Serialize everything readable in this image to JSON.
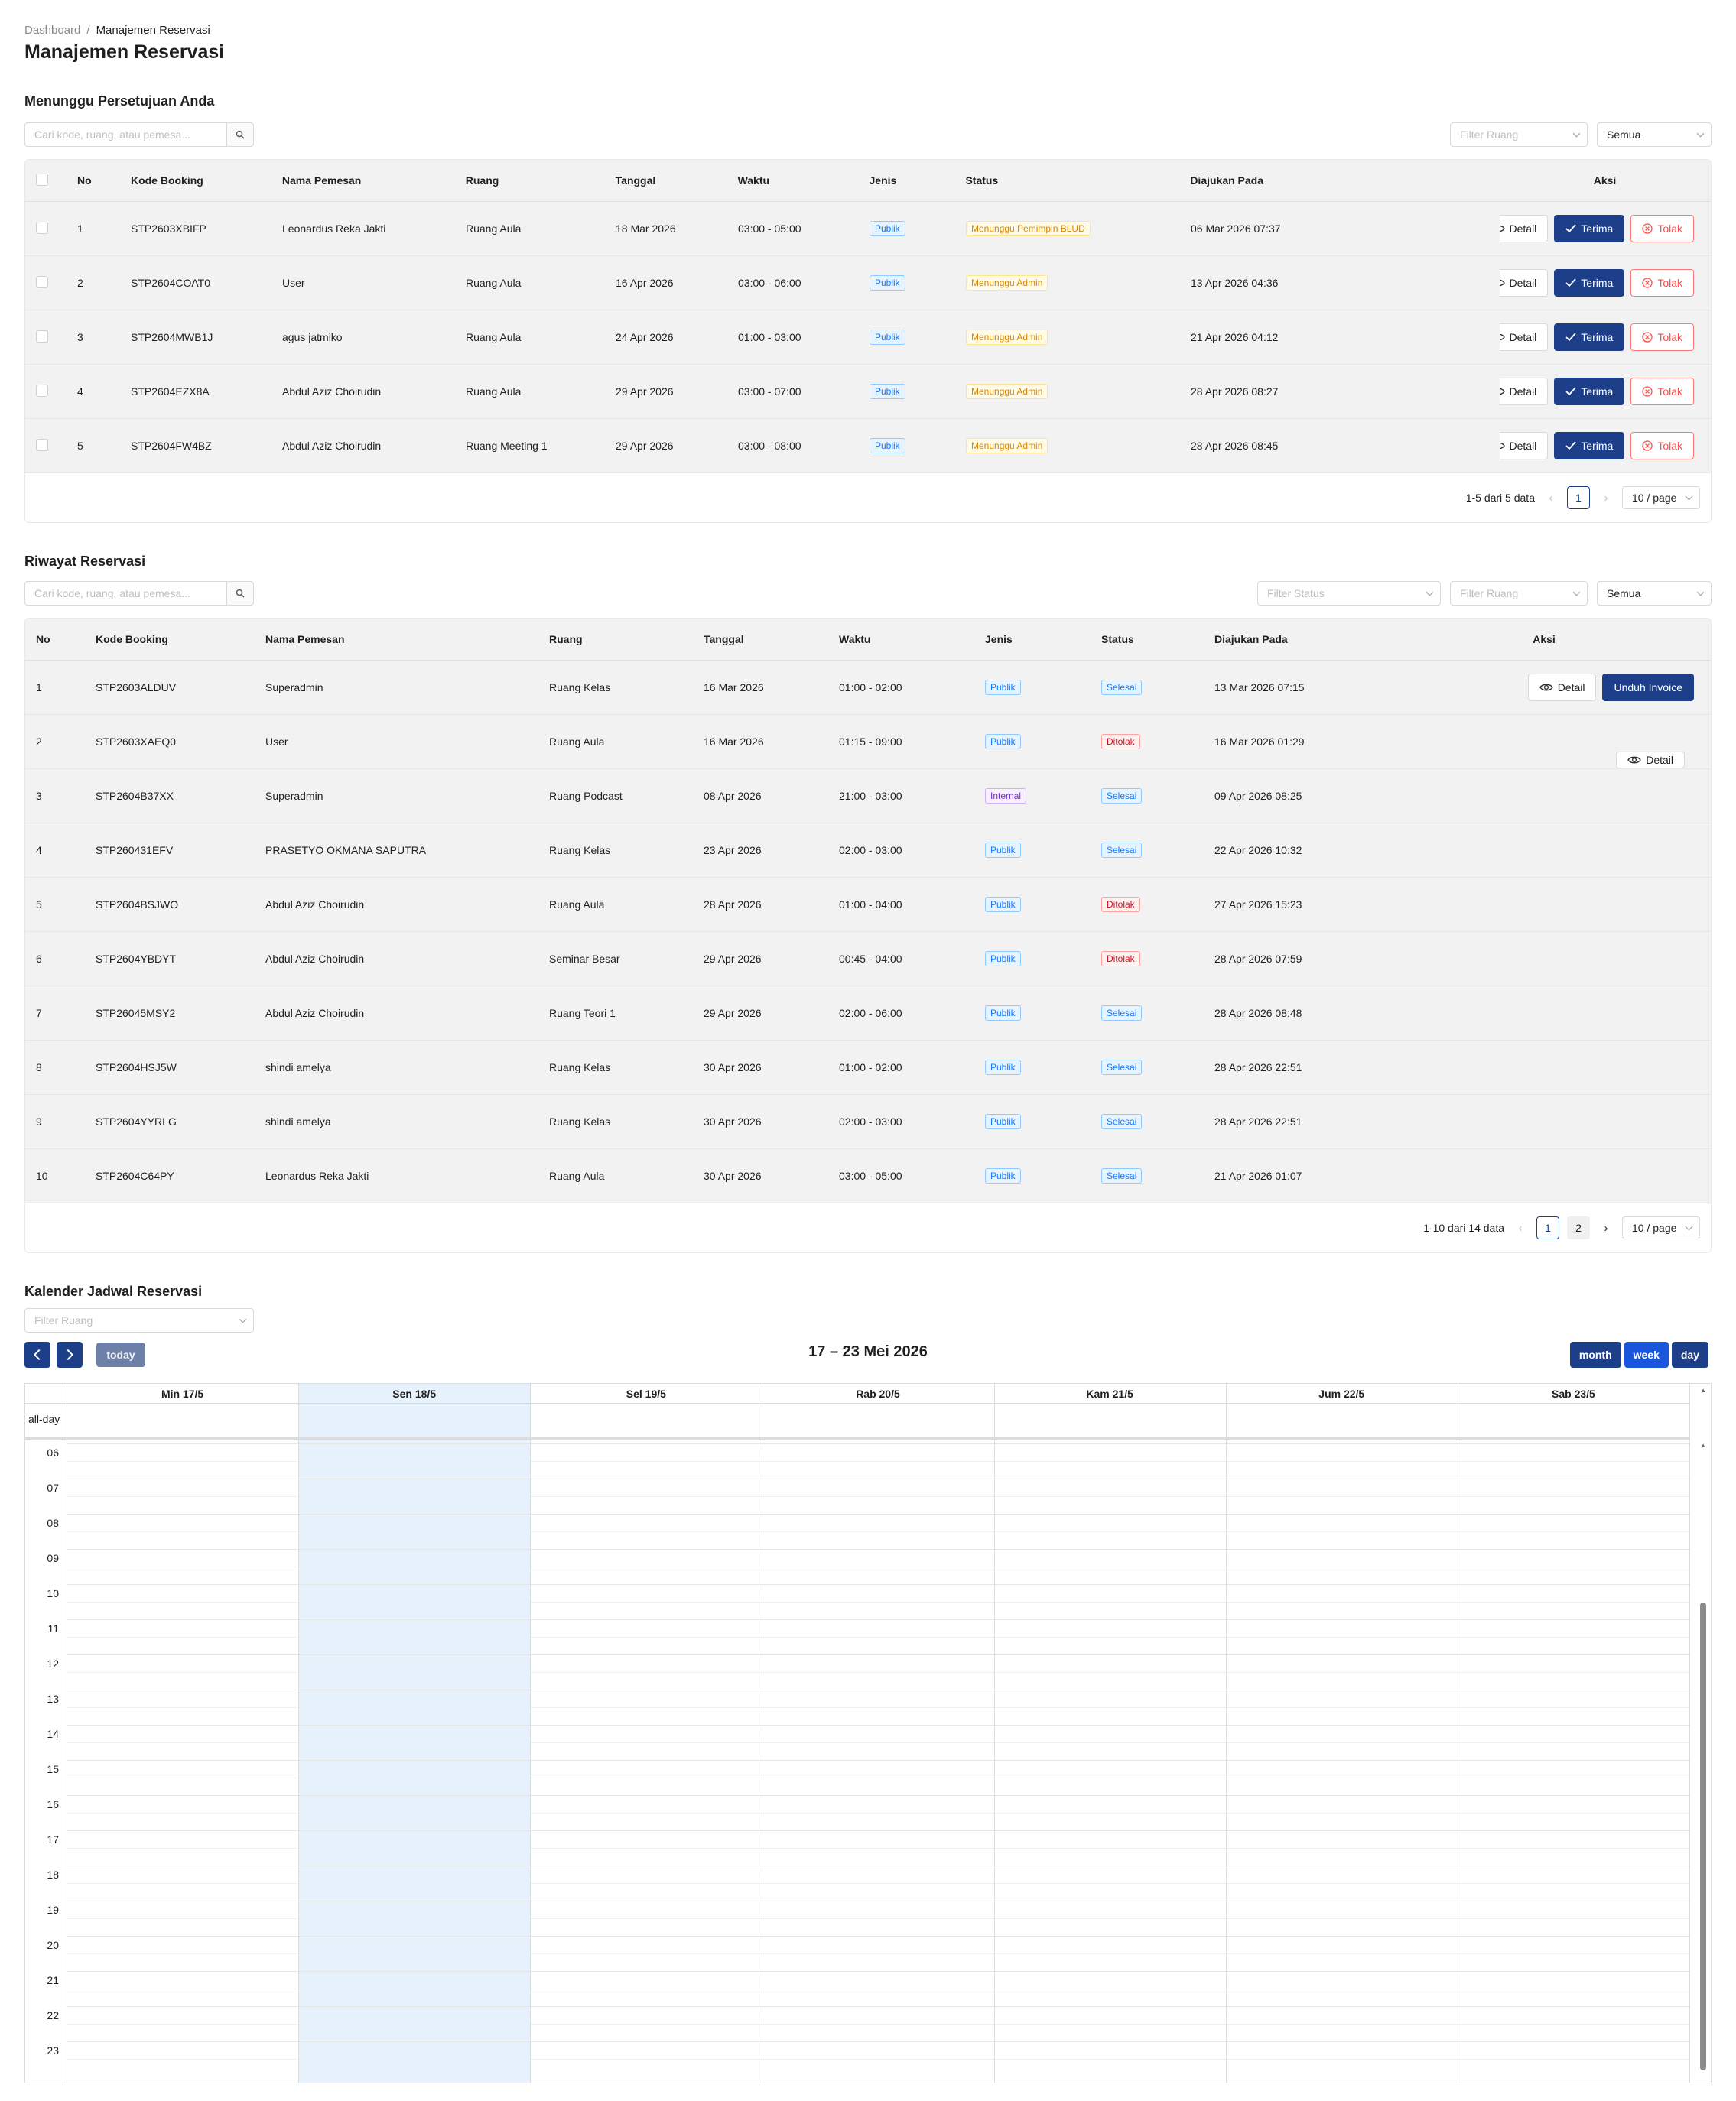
{
  "breadcrumb": {
    "home": "Dashboard",
    "sep": "/",
    "current": "Manajemen Reservasi"
  },
  "page_title": "Manajemen Reservasi",
  "pending": {
    "title": "Menunggu Persetujuan Anda",
    "search_placeholder": "Cari kode, ruang, atau pemesa...",
    "filter_room": "Filter Ruang",
    "filter_all": "Semua",
    "headers": [
      "No",
      "Kode Booking",
      "Nama Pemesan",
      "Ruang",
      "Tanggal",
      "Waktu",
      "Jenis",
      "Status",
      "Diajukan Pada",
      "Aksi"
    ],
    "rows": [
      {
        "no": "1",
        "code": "STP2603XBIFP",
        "name": "Leonardus Reka Jakti",
        "room": "Ruang Aula",
        "date": "18 Mar 2026",
        "time": "03:00 - 05:00",
        "type": "Publik",
        "status": "Menunggu Pemimpin BLUD",
        "submitted": "06 Mar 2026 07:37"
      },
      {
        "no": "2",
        "code": "STP2604COAT0",
        "name": "User",
        "room": "Ruang Aula",
        "date": "16 Apr 2026",
        "time": "03:00 - 06:00",
        "type": "Publik",
        "status": "Menunggu Admin",
        "submitted": "13 Apr 2026 04:36"
      },
      {
        "no": "3",
        "code": "STP2604MWB1J",
        "name": "agus jatmiko",
        "room": "Ruang Aula",
        "date": "24 Apr 2026",
        "time": "01:00 - 03:00",
        "type": "Publik",
        "status": "Menunggu Admin",
        "submitted": "21 Apr 2026 04:12"
      },
      {
        "no": "4",
        "code": "STP2604EZX8A",
        "name": "Abdul Aziz Choirudin",
        "room": "Ruang Aula",
        "date": "29 Apr 2026",
        "time": "03:00 - 07:00",
        "type": "Publik",
        "status": "Menunggu Admin",
        "submitted": "28 Apr 2026 08:27"
      },
      {
        "no": "5",
        "code": "STP2604FW4BZ",
        "name": "Abdul Aziz Choirudin",
        "room": "Ruang Meeting 1",
        "date": "29 Apr 2026",
        "time": "03:00 - 08:00",
        "type": "Publik",
        "status": "Menunggu Admin",
        "submitted": "28 Apr 2026 08:45"
      }
    ],
    "btn_detail": "Detail",
    "btn_accept": "Terima",
    "btn_reject": "Tolak",
    "pager_info": "1-5 dari 5 data",
    "page_current": "1",
    "page_size": "10 / page"
  },
  "history": {
    "title": "Riwayat Reservasi",
    "search_placeholder": "Cari kode, ruang, atau pemesa...",
    "filter_status": "Filter Status",
    "filter_room": "Filter Ruang",
    "filter_all": "Semua",
    "headers": [
      "No",
      "Kode Booking",
      "Nama Pemesan",
      "Ruang",
      "Tanggal",
      "Waktu",
      "Jenis",
      "Status",
      "Diajukan Pada",
      "Aksi"
    ],
    "rows": [
      {
        "no": "1",
        "code": "STP2603ALDUV",
        "name": "Superadmin",
        "room": "Ruang Kelas",
        "date": "16 Mar 2026",
        "time": "01:00 - 02:00",
        "type": "Publik",
        "status": "Selesai",
        "submitted": "13 Mar 2026 07:15"
      },
      {
        "no": "2",
        "code": "STP2603XAEQ0",
        "name": "User",
        "room": "Ruang Aula",
        "date": "16 Mar 2026",
        "time": "01:15 - 09:00",
        "type": "Publik",
        "status": "Ditolak",
        "submitted": "16 Mar 2026 01:29"
      },
      {
        "no": "3",
        "code": "STP2604B37XX",
        "name": "Superadmin",
        "room": "Ruang Podcast",
        "date": "08 Apr 2026",
        "time": "21:00 - 03:00",
        "type": "Internal",
        "status": "Selesai",
        "submitted": "09 Apr 2026 08:25"
      },
      {
        "no": "4",
        "code": "STP260431EFV",
        "name": "PRASETYO OKMANA SAPUTRA",
        "room": "Ruang Kelas",
        "date": "23 Apr 2026",
        "time": "02:00 - 03:00",
        "type": "Publik",
        "status": "Selesai",
        "submitted": "22 Apr 2026 10:32"
      },
      {
        "no": "5",
        "code": "STP2604BSJWO",
        "name": "Abdul Aziz Choirudin",
        "room": "Ruang Aula",
        "date": "28 Apr 2026",
        "time": "01:00 - 04:00",
        "type": "Publik",
        "status": "Ditolak",
        "submitted": "27 Apr 2026 15:23"
      },
      {
        "no": "6",
        "code": "STP2604YBDYT",
        "name": "Abdul Aziz Choirudin",
        "room": "Seminar Besar",
        "date": "29 Apr 2026",
        "time": "00:45 - 04:00",
        "type": "Publik",
        "status": "Ditolak",
        "submitted": "28 Apr 2026 07:59"
      },
      {
        "no": "7",
        "code": "STP26045MSY2",
        "name": "Abdul Aziz Choirudin",
        "room": "Ruang Teori 1",
        "date": "29 Apr 2026",
        "time": "02:00 - 06:00",
        "type": "Publik",
        "status": "Selesai",
        "submitted": "28 Apr 2026 08:48"
      },
      {
        "no": "8",
        "code": "STP2604HSJ5W",
        "name": "shindi amelya",
        "room": "Ruang Kelas",
        "date": "30 Apr 2026",
        "time": "01:00 - 02:00",
        "type": "Publik",
        "status": "Selesai",
        "submitted": "28 Apr 2026 22:51"
      },
      {
        "no": "9",
        "code": "STP2604YYRLG",
        "name": "shindi amelya",
        "room": "Ruang Kelas",
        "date": "30 Apr 2026",
        "time": "02:00 - 03:00",
        "type": "Publik",
        "status": "Selesai",
        "submitted": "28 Apr 2026 22:51"
      },
      {
        "no": "10",
        "code": "STP2604C64PY",
        "name": "Leonardus Reka Jakti",
        "room": "Ruang Aula",
        "date": "30 Apr 2026",
        "time": "03:00 - 05:00",
        "type": "Publik",
        "status": "Selesai",
        "submitted": "21 Apr 2026 01:07"
      }
    ],
    "btn_detail": "Detail",
    "btn_invoice": "Unduh Invoice",
    "pager_info": "1-10 dari 14 data",
    "page_current": "1",
    "page_next": "2",
    "page_size": "10 / page"
  },
  "calendar": {
    "title": "Kalender Jadwal Reservasi",
    "filter_room": "Filter Ruang",
    "today_label": "today",
    "range_title": "17 – 23 Mei 2026",
    "views": [
      "month",
      "week",
      "day"
    ],
    "active_view": "week",
    "days": [
      "Min 17/5",
      "Sen 18/5",
      "Sel 19/5",
      "Rab 20/5",
      "Kam 21/5",
      "Jum 22/5",
      "Sab 23/5"
    ],
    "today_column": "Sen 18/5",
    "allday_label": "all-day",
    "hours": [
      "06",
      "07",
      "08",
      "09",
      "10",
      "11",
      "12",
      "13",
      "14",
      "15",
      "16",
      "17",
      "18",
      "19",
      "20",
      "21",
      "22",
      "23"
    ]
  },
  "colors": {
    "primary": "#1d3f8a",
    "today_highlight": "#e8f2fc",
    "tag_blue": "#1677ff",
    "tag_orange": "#d48806",
    "tag_red": "#cf1322",
    "tag_purple": "#722ed1"
  }
}
